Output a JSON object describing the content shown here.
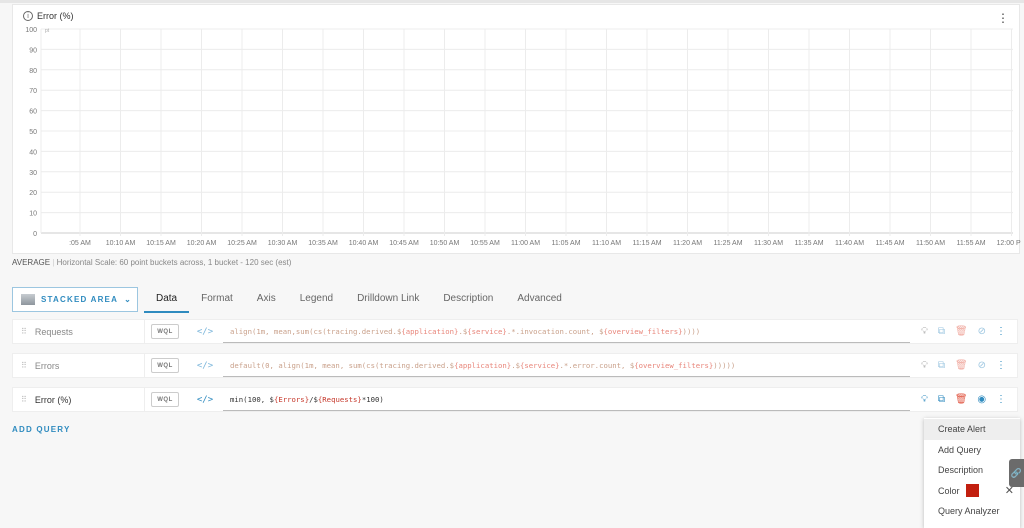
{
  "chart": {
    "title": "Error (%)",
    "unit": "pt",
    "y_ticks": [
      "100",
      "90",
      "80",
      "70",
      "60",
      "50",
      "40",
      "30",
      "20",
      "10",
      "0"
    ],
    "x_ticks": [
      ":05 AM",
      "10:10 AM",
      "10:15 AM",
      "10:20 AM",
      "10:25 AM",
      "10:30 AM",
      "10:35 AM",
      "10:40 AM",
      "10:45 AM",
      "10:50 AM",
      "10:55 AM",
      "11:00 AM",
      "11:05 AM",
      "11:10 AM",
      "11:15 AM",
      "11:20 AM",
      "11:25 AM",
      "11:30 AM",
      "11:35 AM",
      "11:40 AM",
      "11:45 AM",
      "11:50 AM",
      "11:55 AM",
      "12:00 PM"
    ]
  },
  "scale": {
    "mode": "AVERAGE",
    "sep": "|",
    "text": "Horizontal Scale: 60 point buckets across, 1 bucket - 120 sec (est)"
  },
  "chart_type_button": "STACKED AREA",
  "tabs": [
    "Data",
    "Format",
    "Axis",
    "Legend",
    "Drilldown Link",
    "Description",
    "Advanced"
  ],
  "queries": [
    {
      "name": "Requests",
      "mode": "WQL",
      "expr": [
        [
          "align(1m, mean,sum(cs(tracing.derived.$",
          ""
        ],
        [
          "{application}",
          "v"
        ],
        [
          ".$",
          ""
        ],
        [
          "{service}",
          "v"
        ],
        [
          ".*.invocation.count, $",
          ""
        ],
        [
          "{overview_filters}",
          "v"
        ],
        [
          "))))",
          ""
        ]
      ]
    },
    {
      "name": "Errors",
      "mode": "WQL",
      "expr": [
        [
          "default(0, align(1m, mean, sum(cs(tracing.derived.$",
          ""
        ],
        [
          "{application}",
          "v"
        ],
        [
          ".$",
          ""
        ],
        [
          "{service}",
          "v"
        ],
        [
          ".*.error.count, $",
          ""
        ],
        [
          "{overview_filters}",
          "v"
        ],
        [
          ")))))",
          ""
        ]
      ]
    },
    {
      "name": "Error (%)",
      "mode": "WQL",
      "expr": [
        [
          "min(100, $",
          ""
        ],
        [
          "{Errors}",
          "v"
        ],
        [
          "/$",
          ""
        ],
        [
          "{Requests}",
          "v"
        ],
        [
          "*100)",
          ""
        ]
      ]
    }
  ],
  "add_query": "ADD QUERY",
  "menu": {
    "items": [
      "Create Alert",
      "Add Query",
      "Description",
      "Color",
      "Query Analyzer"
    ],
    "color": "#c21f0f"
  },
  "accent": "#2f8bbf"
}
